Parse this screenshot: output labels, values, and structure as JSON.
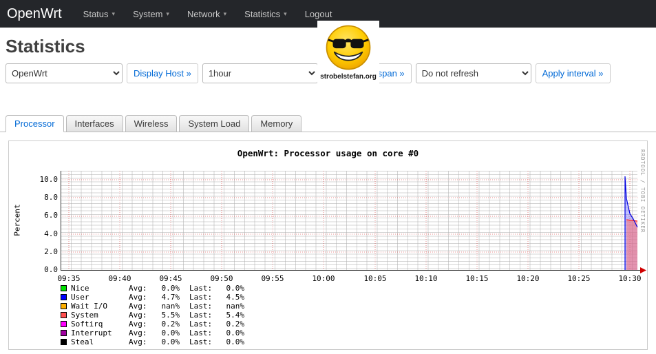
{
  "colors": {
    "navbar_bg": "#24262a",
    "accent_blue": "#0069d6"
  },
  "navbar": {
    "brand": "OpenWrt",
    "caret": "▾",
    "items": [
      {
        "label": "Status",
        "dropdown": true
      },
      {
        "label": "System",
        "dropdown": true
      },
      {
        "label": "Network",
        "dropdown": true
      },
      {
        "label": "Statistics",
        "dropdown": true
      },
      {
        "label": "Logout",
        "dropdown": false
      }
    ]
  },
  "watermark": {
    "caption": "strobelstefan.org"
  },
  "page": {
    "title": "Statistics"
  },
  "controls": {
    "host_select_value": "OpenWrt",
    "display_host_label": "Display Host »",
    "timespan_select_value": "1hour",
    "display_timespan_label": "Display timespan »",
    "refresh_select_value": "Do not refresh",
    "apply_interval_label": "Apply interval »"
  },
  "tabs": [
    {
      "label": "Processor",
      "active": true
    },
    {
      "label": "Interfaces",
      "active": false
    },
    {
      "label": "Wireless",
      "active": false
    },
    {
      "label": "System Load",
      "active": false
    },
    {
      "label": "Memory",
      "active": false
    }
  ],
  "chart_data": {
    "type": "area",
    "title": "OpenWrt: Processor usage on core #0",
    "ylabel": "Percent",
    "rrd_watermark": "RRDTOOL / TOBI OETIKER",
    "grid": true,
    "legend_position": "bottom-left",
    "x_range": [
      "09:33",
      "10:31"
    ],
    "ylim": [
      0,
      11
    ],
    "x_ticks": [
      "09:35",
      "09:40",
      "09:45",
      "09:50",
      "09:55",
      "10:00",
      "10:05",
      "10:10",
      "10:15",
      "10:20",
      "10:25",
      "10:30"
    ],
    "y_ticks": [
      "10.0",
      "8.0",
      "6.0",
      "4.0",
      "2.0",
      "0.0"
    ],
    "legend_labels": {
      "avg": "Avg:",
      "last": "Last:"
    },
    "series": [
      {
        "name": "Nice",
        "color": "#00e000",
        "avg": "0.0%",
        "last": "0.0%"
      },
      {
        "name": "User",
        "color": "#0000ff",
        "avg": "4.7%",
        "last": "4.5%"
      },
      {
        "name": "Wait I/O",
        "color": "#ffb000",
        "avg": "nan%",
        "last": "nan%"
      },
      {
        "name": "System",
        "color": "#ff5050",
        "avg": "5.5%",
        "last": "5.4%"
      },
      {
        "name": "Softirq",
        "color": "#ff00ff",
        "avg": "0.2%",
        "last": "0.2%"
      },
      {
        "name": "Interrupt",
        "color": "#a000a0",
        "avg": "0.0%",
        "last": "0.0%"
      },
      {
        "name": "Steal",
        "color": "#000000",
        "avg": "0.0%",
        "last": "0.0%"
      }
    ],
    "visible_points": {
      "note": "no data before ~10:29; spike at right edge of window",
      "x": [
        "10:29",
        "10:29.5",
        "10:30",
        "10:31"
      ],
      "User": [
        0,
        10.4,
        6.0,
        4.5
      ],
      "System": [
        5.5,
        5.5,
        5.5,
        5.4
      ]
    }
  }
}
